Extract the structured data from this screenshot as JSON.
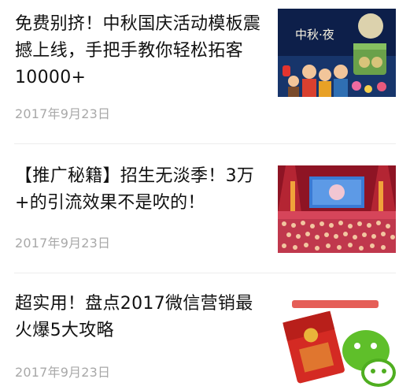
{
  "articles": [
    {
      "title": "免费别挤！中秋国庆活动模板震撼上线，手把手教你轻松拓客10000+",
      "date": "2017年9月23日",
      "thumbnail": {
        "icon": "mid-autumn-poster-image",
        "caption": "中秋·夜",
        "colors": {
          "sky": "#0d1f4a",
          "moon": "#f3e6b8",
          "box": "#6aa14a"
        }
      }
    },
    {
      "title": "【推广秘籍】招生无淡季！3万+的引流效果不是吹的！",
      "date": "2017年9月23日",
      "thumbnail": {
        "icon": "stage-performance-image",
        "colors": {
          "stage": "#b51a2a",
          "screen": "#3a7bd5",
          "crowd": "#d6455a"
        }
      }
    },
    {
      "title": "超实用！盘点2017微信营销最火爆5大攻略",
      "date": "2017年9月23日",
      "thumbnail": {
        "icon": "wechat-red-packet-image",
        "colors": {
          "packet": "#d42a23",
          "wechat": "#5fbf2a",
          "gold": "#e9b43a"
        }
      }
    }
  ]
}
